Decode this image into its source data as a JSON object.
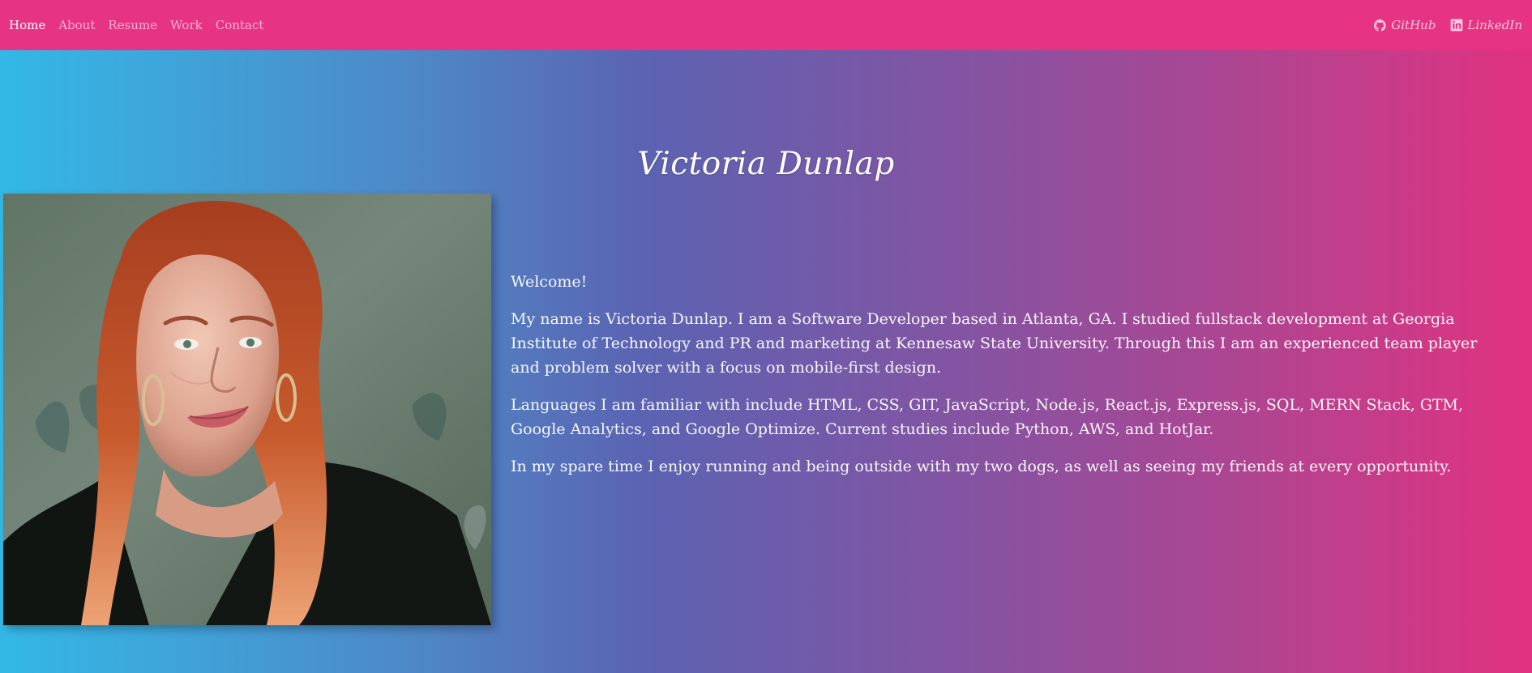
{
  "nav": {
    "links": [
      "Home",
      "About",
      "Resume",
      "Work",
      "Contact"
    ],
    "social": [
      {
        "label": "GitHub",
        "icon": "github-icon"
      },
      {
        "label": "LinkedIn",
        "icon": "linkedin-icon"
      }
    ]
  },
  "hero": {
    "title": "Victoria Dunlap"
  },
  "about": {
    "greeting": "Welcome!",
    "paragraph_1": "My name is Victoria Dunlap. I am a Software Developer based in Atlanta, GA. I studied fullstack development at Georgia Institute of Technology and PR and marketing at Kennesaw State University. Through this I am an experienced team player and problem solver with a focus on mobile-first design.",
    "paragraph_2": "Languages I am familiar with include HTML, CSS, GIT, JavaScript, Node.js, React.js, Express.js, SQL, MERN Stack, GTM, Google Analytics, and Google Optimize. Current studies include Python, AWS, and HotJar.",
    "paragraph_3": "In my spare time I enjoy running and being outside with my two dogs, as well as seeing my friends at every opportunity."
  },
  "colors": {
    "navbar": "#e73384",
    "gradient_start": "#33b8e6",
    "gradient_end": "#e13280"
  }
}
